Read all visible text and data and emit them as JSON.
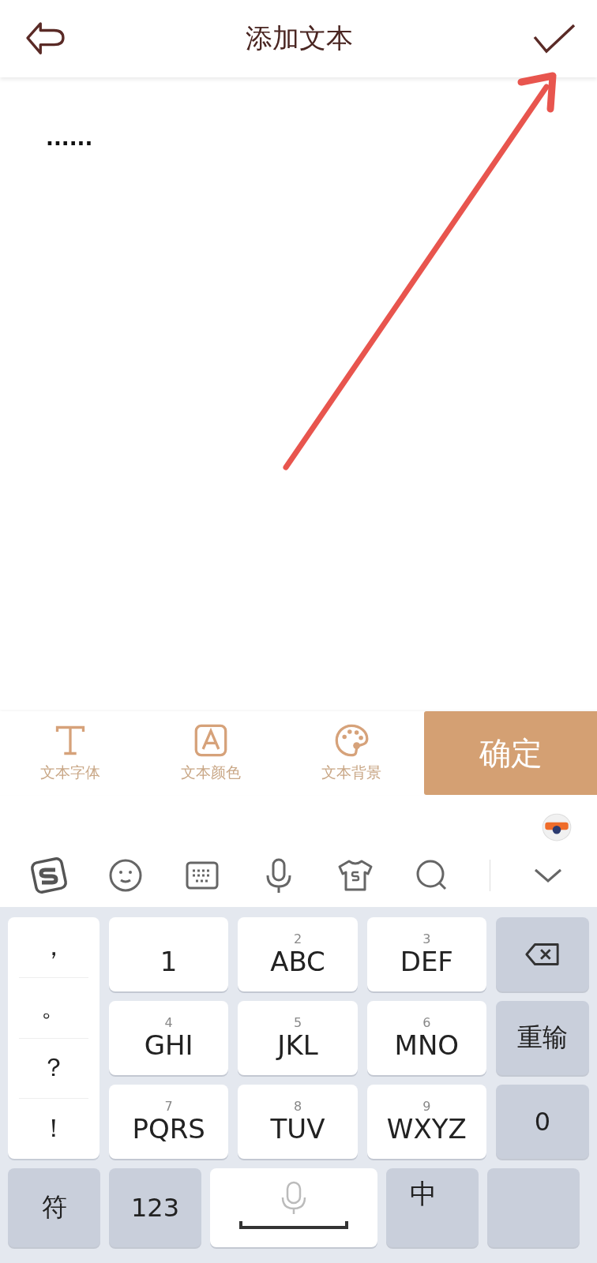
{
  "header": {
    "title": "添加文本"
  },
  "editor": {
    "value": "......"
  },
  "toolbar": {
    "tools": [
      {
        "kind": "font",
        "label": "文本字体"
      },
      {
        "kind": "color",
        "label": "文本颜色"
      },
      {
        "kind": "background",
        "label": "文本背景"
      }
    ],
    "confirm": "确定"
  },
  "ime_bar": {
    "icons": [
      {
        "kind": "logo"
      },
      {
        "kind": "emoji"
      },
      {
        "kind": "keyboard"
      },
      {
        "kind": "mic"
      },
      {
        "kind": "skin"
      },
      {
        "kind": "search"
      },
      {
        "kind": "collapse"
      }
    ]
  },
  "keyboard": {
    "punctuation": [
      "，",
      "。",
      "？",
      "！"
    ],
    "keys": [
      {
        "kind": "digit",
        "label": "1"
      },
      {
        "kind": "digit",
        "hint": "2",
        "label": "ABC"
      },
      {
        "kind": "digit",
        "hint": "3",
        "label": "DEF"
      },
      {
        "kind": "delete"
      },
      {
        "kind": "digit",
        "hint": "4",
        "label": "GHI"
      },
      {
        "kind": "digit",
        "hint": "5",
        "label": "JKL"
      },
      {
        "kind": "digit",
        "hint": "6",
        "label": "MNO"
      },
      {
        "kind": "func",
        "label": "重输"
      },
      {
        "kind": "digit",
        "hint": "7",
        "label": "PQRS"
      },
      {
        "kind": "digit",
        "hint": "8",
        "label": "TUV"
      },
      {
        "kind": "digit",
        "hint": "9",
        "label": "WXYZ"
      },
      {
        "kind": "func",
        "label": "0"
      }
    ],
    "bottom": [
      {
        "kind": "func",
        "label": "符"
      },
      {
        "kind": "func",
        "label": "123"
      },
      {
        "kind": "space"
      },
      {
        "kind": "lang",
        "label": "中"
      },
      {
        "kind": "enter"
      }
    ]
  }
}
